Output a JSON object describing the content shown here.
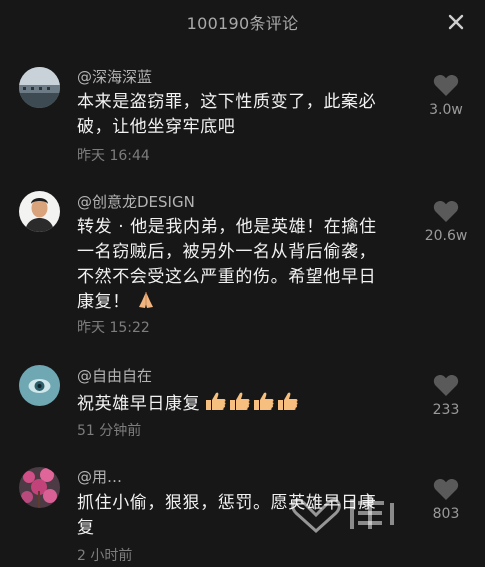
{
  "header": {
    "title": "100190条评论"
  },
  "comments": [
    {
      "username": "@深海深蓝",
      "lines": [
        "本来是盗窃罪，这下性质变了，此案必",
        "破，让他坐穿牢底吧"
      ],
      "time": "昨天 16:44",
      "likes": "3.0w"
    },
    {
      "username": "@创意龙DESIGN",
      "lines": [
        "转发 · 他是我内弟，他是英雄！在擒住",
        "一名窃贼后，被另外一名从背后偷袭，",
        "不然不会受这么严重的伤。希望他早日",
        "康复！"
      ],
      "time": "昨天 15:22",
      "likes": "20.6w"
    },
    {
      "username": "@自由自在",
      "lines": [
        "祝英雄早日康复"
      ],
      "time": "51 分钟前",
      "likes": "233"
    },
    {
      "username": "@用…",
      "lines": [
        "抓住小偷，狠狠，惩罚。愿英雄早日康",
        "复"
      ],
      "time": "2 小时前",
      "likes": "803"
    }
  ],
  "icons": {
    "close": "close-icon",
    "like": "heart-icon",
    "pray": "folded-hands-icon",
    "thumbs": "thumbs-up-icon"
  },
  "colors": {
    "background": "#171717",
    "primary_text": "#f2f2f2",
    "secondary_text": "#b3b3b3",
    "muted_text": "#7d7d7d",
    "heart": "#5a5a5a"
  }
}
